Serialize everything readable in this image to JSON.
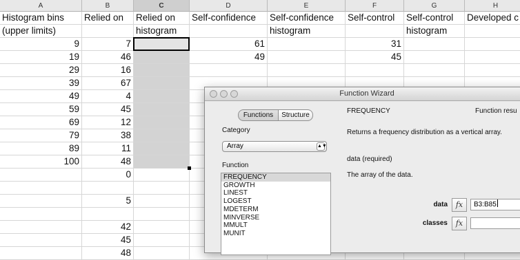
{
  "spreadsheet": {
    "columns": [
      "A",
      "B",
      "C",
      "D",
      "E",
      "F",
      "G",
      "H"
    ],
    "active_column": "C",
    "row1": {
      "A": "Histogram bins",
      "B": "Relied on",
      "C": "Relied on",
      "D": "Self-confidence",
      "E": "Self-confidence",
      "F": "Self-control",
      "G": "Self-control",
      "H": "Developed c"
    },
    "row2": {
      "A": "(upper limits)",
      "C": "histogram",
      "E": "histogram",
      "G": "histogram"
    },
    "colA": [
      "9",
      "19",
      "29",
      "39",
      "49",
      "59",
      "69",
      "79",
      "89",
      "100"
    ],
    "colB": [
      "7",
      "46",
      "16",
      "67",
      "4",
      "45",
      "12",
      "38",
      "11",
      "48",
      "0",
      "",
      "5",
      "",
      "42",
      "45",
      "48"
    ],
    "colD": [
      "61",
      "49"
    ],
    "colF": [
      "31",
      "45"
    ]
  },
  "dialog": {
    "title": "Function Wizard",
    "tabs": [
      "Functions",
      "Structure"
    ],
    "category_label": "Category",
    "category_value": "Array",
    "function_label": "Function",
    "functions": [
      "FREQUENCY",
      "GROWTH",
      "LINEST",
      "LOGEST",
      "MDETERM",
      "MINVERSE",
      "MMULT",
      "MUNIT"
    ],
    "selected_function": "FREQUENCY",
    "func_name": "FREQUENCY",
    "result_label": "Function resu",
    "description": "Returns a frequency distribution as a vertical array.",
    "param_required": "data (required)",
    "param_desc": "The array of the data.",
    "args": [
      {
        "label": "data",
        "value": "B3:B85"
      },
      {
        "label": "classes",
        "value": ""
      }
    ],
    "fx_symbol": "fx"
  }
}
